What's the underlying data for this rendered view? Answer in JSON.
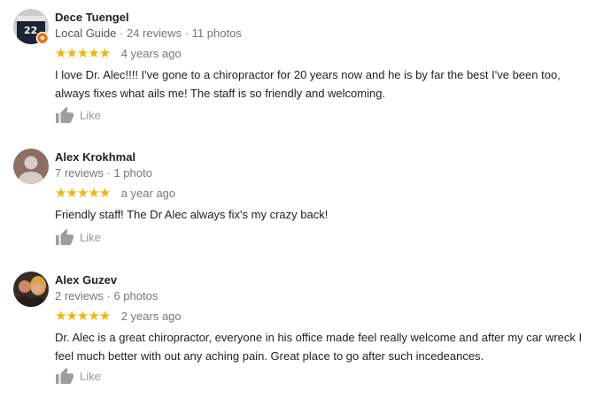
{
  "reviews": [
    {
      "author": "Dece Tuengel",
      "local_guide": "Local Guide",
      "stats": "24 reviews · 11 photos",
      "rating": 5,
      "stars": "★★★★★",
      "time": "4 years ago",
      "text": "I love Dr. Alec!!!!  I've gone to a chiropractor for 20 years now and he is by far the best I've been too, always fixes what ails me! The staff is so friendly and welcoming.",
      "like_label": "Like"
    },
    {
      "author": "Alex Krokhmal",
      "stats": "7 reviews · 1 photo",
      "rating": 5,
      "stars": "★★★★★",
      "time": "a year ago",
      "text": "Friendly staff! The Dr Alec always fix's my crazy back!",
      "like_label": "Like"
    },
    {
      "author": "Alex Guzev",
      "stats": "2 reviews · 6 photos",
      "rating": 5,
      "stars": "★★★★★",
      "time": "2 years ago",
      "text": "Dr. Alec is a great chiropractor, everyone in his office made feel really welcome and after my car wreck I feel much better with out any aching pain. Great place to go after such incedeances.",
      "like_label": "Like"
    }
  ],
  "colors": {
    "star": "#f4b400",
    "muted": "#777777",
    "like_icon": "#9e9e9e",
    "guide_badge": "#e8710a"
  },
  "icons": {
    "like": "thumbs-up-icon",
    "guide_badge": "local-guide-badge-icon"
  }
}
